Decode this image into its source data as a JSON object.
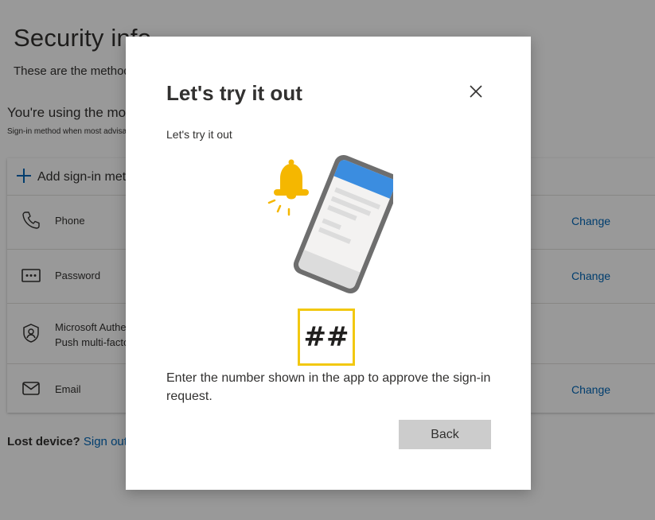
{
  "page": {
    "title": "Security info",
    "subtitle": "These are the methods you use to sign into your account or reset your password.",
    "default_heading": "You're using the most advisable sign-in method where it applies.",
    "default_note": "Sign-in method when most advisable is unavailable:",
    "add_method_label": "Add sign-in method",
    "methods": [
      {
        "icon": "phone-icon",
        "label": "Phone",
        "sub": "",
        "action": "Change"
      },
      {
        "icon": "password-icon",
        "label": "Password",
        "sub": "",
        "action": "Change"
      },
      {
        "icon": "authenticator-icon",
        "label": "Microsoft Authenticator",
        "sub": "Push multi-factor authentication (MFA)",
        "action": ""
      },
      {
        "icon": "email-icon",
        "label": "Email",
        "sub": "",
        "action": "Change"
      }
    ],
    "lost_device_label": "Lost device?",
    "lost_device_link": "Sign out everywhere"
  },
  "dialog": {
    "title": "Let's try it out",
    "subtitle": "Let's try it out",
    "number": "##",
    "message": "Enter the number shown in the app to approve the sign-in request.",
    "back_label": "Back"
  },
  "colors": {
    "link": "#0067b8",
    "accent_blue": "#3b8de0",
    "bell": "#f5b700",
    "number_border": "#f2c811",
    "button_bg": "#cccccc"
  }
}
